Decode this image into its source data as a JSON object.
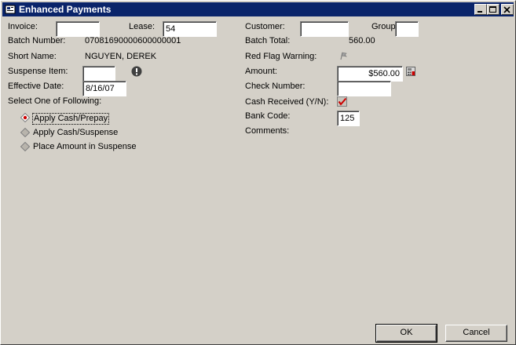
{
  "window": {
    "title": "Enhanced Payments"
  },
  "left": {
    "invoice_label": "Invoice:",
    "invoice_value": "",
    "lease_label": "Lease:",
    "lease_value": "54",
    "batch_number_label": "Batch Number:",
    "batch_number_value": "07081690000600000001",
    "short_name_label": "Short Name:",
    "short_name_value": "NGUYEN, DEREK",
    "suspense_item_label": "Suspense Item:",
    "suspense_item_value": "",
    "effective_date_label": "Effective Date:",
    "effective_date_value": "8/16/07",
    "select_label": "Select One of Following:",
    "options": [
      {
        "label": "Apply Cash/Prepay",
        "selected": true
      },
      {
        "label": "Apply Cash/Suspense",
        "selected": false
      },
      {
        "label": "Place Amount in Suspense",
        "selected": false
      }
    ]
  },
  "right": {
    "customer_label": "Customer:",
    "customer_value": "",
    "group_label": "Group",
    "group_value": "",
    "batch_total_label": "Batch Total:",
    "batch_total_value": "560.00",
    "red_flag_label": "Red Flag Warning:",
    "amount_label": "Amount:",
    "amount_value": "$560.00",
    "check_number_label": "Check Number:",
    "check_number_value": "",
    "cash_received_label": "Cash Received (Y/N):",
    "cash_received_checked": true,
    "bank_code_label": "Bank Code:",
    "bank_code_value": "125",
    "comments_label": "Comments:"
  },
  "buttons": {
    "ok": "OK",
    "cancel": "Cancel"
  },
  "icons": {
    "app": "payments-app-icon",
    "suspense_warning": "exclamation-circle-icon",
    "red_flag": "flag-icon",
    "amount_calc": "calculator-icon",
    "cash_received": "checkbox-checked-icon"
  },
  "colors": {
    "title_bar": "#0a246a",
    "face": "#d4d0c8",
    "check_red": "#cc0000"
  }
}
